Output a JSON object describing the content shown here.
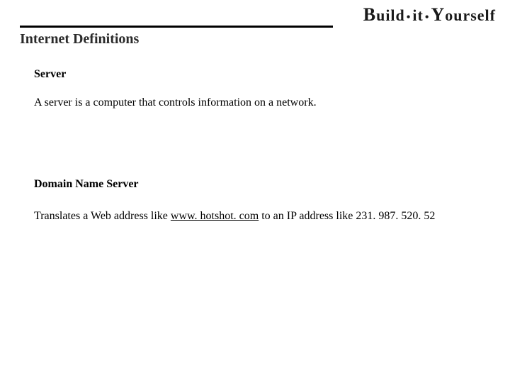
{
  "header": {
    "logo_parts": {
      "b": "B",
      "uild": "uild",
      "sep": "•",
      "it": "it",
      "y": "Y",
      "ourself": "ourself"
    },
    "title": "Internet Definitions"
  },
  "sections": [
    {
      "term": "Server",
      "definition": "A server is a computer that controls information on a network."
    },
    {
      "term": "Domain Name Server",
      "definition_pre": "Translates a Web address like ",
      "link_text": "www. hotshot. com",
      "definition_post": " to an IP address like 231. 987. 520. 52"
    }
  ]
}
